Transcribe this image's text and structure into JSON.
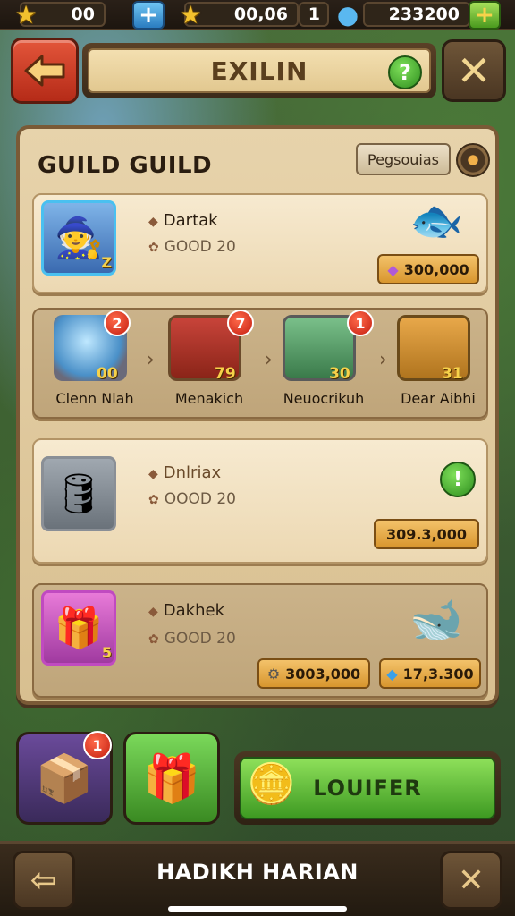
{
  "topbar": {
    "res1_value": "00",
    "res2_value": "00,06",
    "res3_value": "1",
    "res4_value": "233200"
  },
  "header": {
    "title": "EXILIN",
    "help_symbol": "?"
  },
  "panel": {
    "title": "GUILD GUILD",
    "filter_label": "Pegsouias"
  },
  "cards": [
    {
      "name": "Dartak",
      "sub": "GOOD 20",
      "level_badge": "Z",
      "price": "300,000"
    },
    {
      "name": "Dnlriax",
      "sub": "OOOD 20",
      "price": "309.3,000"
    },
    {
      "name": "Dakhek",
      "sub": "GOOD 20",
      "level_badge": "5",
      "price1": "3003,000",
      "price2": "17,3.300"
    }
  ],
  "items": [
    {
      "label": "Clenn Nlah",
      "badge": "2",
      "count": "00"
    },
    {
      "label": "Menakich",
      "badge": "7",
      "count": "79"
    },
    {
      "label": "Neuocrikuh",
      "badge": "1",
      "count": "30"
    },
    {
      "label": "Dear Aibhi",
      "count": "31"
    }
  ],
  "bottom": {
    "slot1_badge": "1",
    "action_label": "LOUIFER",
    "bar_title": "HADIKH HARIAN"
  },
  "colors": {
    "accent_green": "#3e9a22",
    "back_red": "#c83a22",
    "badge_red": "#c41e10",
    "gold": "#f2c12e"
  }
}
